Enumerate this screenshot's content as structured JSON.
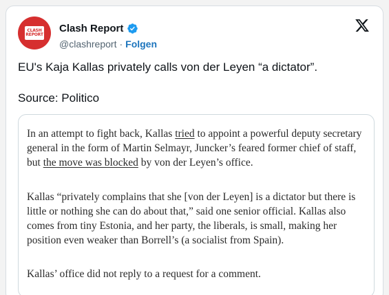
{
  "post": {
    "author_name": "Clash Report",
    "handle": "@clashreport",
    "separator": "·",
    "follow_label": "Folgen",
    "avatar_text_top": "CLASH",
    "avatar_text_bottom": "REPORT",
    "verified_icon": "verified-badge-icon",
    "platform_icon": "x-logo-icon",
    "brand_color": "#d62f2f",
    "link_color": "#1d75bd",
    "verified_color": "#1d9bf0",
    "text_line_1": "EU's Kaja Kallas privately calls von der Leyen “a dictator”.",
    "text_line_2": "Source: Politico"
  },
  "article_image": {
    "paragraph_1": {
      "line_1_a": "In an attempt to fight back, Kallas ",
      "line_1_link": "tried",
      "line_1_b": " to appoint a powerful deputy secretary",
      "line_2": "general in the form of Martin Selmayr, Juncker’s feared former chief of staff,",
      "line_3_a": "but ",
      "line_3_link": "the move was blocked",
      "line_3_b": " by von der Leyen’s office."
    },
    "paragraph_2": {
      "line_1": "Kallas “privately complains that she [von der Leyen] is a dictator but there is",
      "line_2": "little or nothing she can do about that,” said one senior official. Kallas also",
      "line_3": "comes from tiny Estonia, and her party, the liberals, is small, making her",
      "line_4": "position even weaker than Borrell’s (a socialist from Spain)."
    },
    "paragraph_3": {
      "line_1": "Kallas’ office did not reply to a request for a comment."
    }
  }
}
